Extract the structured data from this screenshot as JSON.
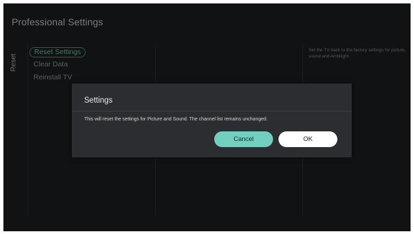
{
  "header": {
    "title": "Professional Settings"
  },
  "side_tab": {
    "label": "Reset"
  },
  "menu": {
    "items": [
      {
        "label": "Reset Settings",
        "selected": true
      },
      {
        "label": "Clear Data",
        "selected": false
      },
      {
        "label": "Reinstall TV",
        "selected": false
      }
    ]
  },
  "info_panel": {
    "text": "Set the TV back to the factory settings for picture, sound and Ambilight."
  },
  "dialog": {
    "title": "Settings",
    "message": "This will reset the settings for Picture and Sound. The channel list remains unchanged.",
    "cancel_label": "Cancel",
    "ok_label": "OK"
  },
  "colors": {
    "background": "#111214",
    "dialog_background": "#2c2d30",
    "accent_cancel": "#72cfc0",
    "ok_button": "#ffffff",
    "selected_item": "#3d7d63"
  }
}
